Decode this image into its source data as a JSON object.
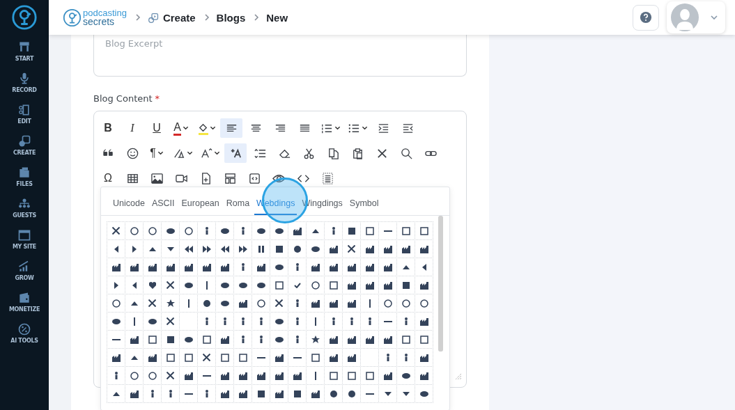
{
  "sidebar": {
    "items": [
      {
        "label": "START",
        "kind": "start"
      },
      {
        "label": "RECORD",
        "kind": "record"
      },
      {
        "label": "EDIT",
        "kind": "edit"
      },
      {
        "label": "CREATE",
        "kind": "create"
      },
      {
        "label": "FILES",
        "kind": "files"
      },
      {
        "label": "GUESTS",
        "kind": "guests"
      },
      {
        "label": "MY SITE",
        "kind": "site"
      },
      {
        "label": "GROW",
        "kind": "grow"
      },
      {
        "label": "MONETIZE",
        "kind": "monetize"
      },
      {
        "label": "AI TOOLS",
        "kind": "ai"
      }
    ]
  },
  "header": {
    "brand": [
      "podcasting",
      "secrets"
    ],
    "breadcrumb": [
      {
        "label": "Create",
        "icon": true
      },
      {
        "label": "Blogs",
        "icon": false
      },
      {
        "label": "New",
        "icon": false
      }
    ]
  },
  "form": {
    "excerpt": {
      "placeholder": "Blog Excerpt"
    },
    "content_label": {
      "text": "Blog Content",
      "required_mark": "*"
    },
    "toolbar": [
      [
        {
          "kind": "bold",
          "label": "B",
          "active": false,
          "dropdown": false
        },
        {
          "kind": "italic",
          "label": "I",
          "active": false,
          "dropdown": false
        },
        {
          "kind": "underline",
          "label": "U",
          "active": false,
          "dropdown": false
        },
        {
          "kind": "text-color",
          "label": "A",
          "color": "#d42a2a",
          "active": false,
          "dropdown": true
        },
        {
          "kind": "highlight",
          "color": "#f5e642",
          "active": false,
          "dropdown": true
        },
        {
          "kind": "align-left",
          "active": true,
          "dropdown": false
        },
        {
          "kind": "align-center",
          "active": false,
          "dropdown": false
        },
        {
          "kind": "align-right",
          "active": false,
          "dropdown": false
        },
        {
          "kind": "justify",
          "active": false,
          "dropdown": false
        },
        {
          "kind": "ordered-list",
          "active": false,
          "dropdown": true
        },
        {
          "kind": "bullet-list",
          "active": false,
          "dropdown": true
        },
        {
          "kind": "indent",
          "active": false,
          "dropdown": false
        },
        {
          "kind": "outdent",
          "active": false,
          "dropdown": false
        }
      ],
      [
        {
          "kind": "quote",
          "active": false,
          "dropdown": false
        },
        {
          "kind": "emoji",
          "active": false,
          "dropdown": false
        },
        {
          "kind": "paragraph",
          "label": "¶",
          "active": false,
          "dropdown": true
        },
        {
          "kind": "font-family",
          "active": false,
          "dropdown": true
        },
        {
          "kind": "font-size",
          "active": false,
          "dropdown": true
        },
        {
          "kind": "add-format",
          "active": true,
          "dropdown": false
        },
        {
          "kind": "line-height",
          "active": false,
          "dropdown": false
        },
        {
          "kind": "eraser",
          "active": false,
          "dropdown": false
        },
        {
          "kind": "cut",
          "active": false,
          "dropdown": false
        },
        {
          "kind": "copy",
          "active": false,
          "dropdown": false
        },
        {
          "kind": "paste",
          "active": false,
          "dropdown": false
        },
        {
          "kind": "remove",
          "active": false,
          "dropdown": false
        },
        {
          "kind": "search",
          "active": false,
          "dropdown": false
        },
        {
          "kind": "link",
          "active": false,
          "dropdown": false
        }
      ],
      [
        {
          "kind": "special-char",
          "label": "Ω",
          "active": false,
          "dropdown": false
        },
        {
          "kind": "table",
          "active": false,
          "dropdown": false
        },
        {
          "kind": "image",
          "active": false,
          "dropdown": false
        },
        {
          "kind": "video",
          "active": false,
          "dropdown": false
        },
        {
          "kind": "file",
          "active": false,
          "dropdown": false
        },
        {
          "kind": "layout",
          "active": false,
          "dropdown": false
        },
        {
          "kind": "embed",
          "active": false,
          "dropdown": false
        },
        {
          "kind": "preview",
          "active": false,
          "dropdown": false
        },
        {
          "kind": "code",
          "active": false,
          "dropdown": false
        },
        {
          "kind": "select-all",
          "active": false,
          "dropdown": false
        }
      ]
    ],
    "special_chars": {
      "tabs": [
        {
          "label": "Unicode",
          "selected": false
        },
        {
          "label": "ASCII",
          "selected": false
        },
        {
          "label": "European",
          "selected": false
        },
        {
          "label": "Roma",
          "selected": false
        },
        {
          "label": "Webdings",
          "selected": true
        },
        {
          "label": "Wingdings",
          "selected": false
        },
        {
          "label": "Symbol",
          "selected": false
        }
      ]
    }
  }
}
